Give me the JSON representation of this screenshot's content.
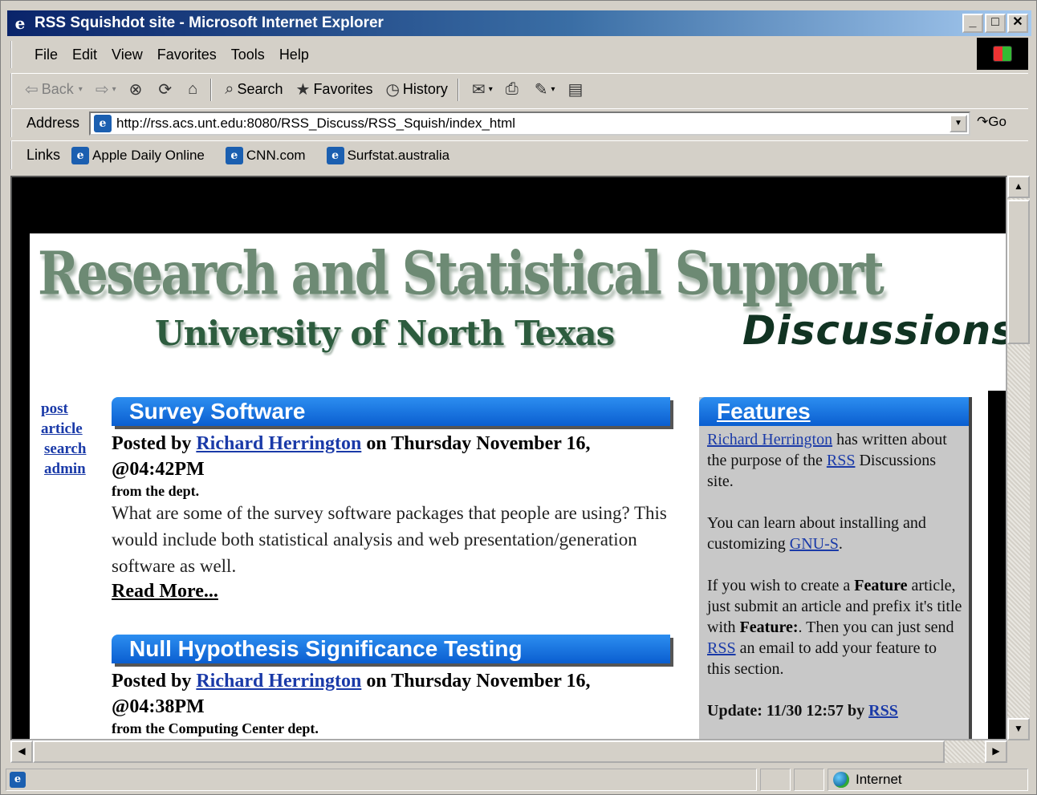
{
  "window": {
    "title": "RSS Squishdot site - Microsoft Internet Explorer"
  },
  "menu": [
    "File",
    "Edit",
    "View",
    "Favorites",
    "Tools",
    "Help"
  ],
  "toolbar": {
    "back": "Back",
    "search": "Search",
    "favorites": "Favorites",
    "history": "History"
  },
  "address": {
    "label": "Address",
    "url": "http://rss.acs.unt.edu:8080/RSS_Discuss/RSS_Squish/index_html",
    "go": "Go"
  },
  "links": {
    "label": "Links",
    "items": [
      "Apple Daily Online",
      "CNN.com",
      "Surfstat.australia"
    ]
  },
  "status": {
    "zone": "Internet"
  },
  "page": {
    "banner": {
      "title": "Research and Statistical Support",
      "subtitle": "University of North Texas",
      "section": "Discussions"
    },
    "nav": [
      "post",
      "article",
      "search",
      "admin"
    ],
    "stories": [
      {
        "title": "Survey Software",
        "posted_by": "Posted by",
        "author": "Richard Herrington",
        "date": "on Thursday November 16, @04:42PM",
        "dept": "from the dept.",
        "body": "What are some of the survey software packages that people are using? This would include both statistical analysis and web presentation/generation software as well.",
        "read_more": "Read More..."
      },
      {
        "title": "Null Hypothesis Significance Testing",
        "posted_by": "Posted by",
        "author": "Richard Herrington",
        "date": "on Thursday November 16, @04:38PM",
        "dept": "from the Computing Center dept."
      }
    ],
    "features": {
      "title": "Features",
      "p1_link": "Richard Herrington",
      "p1_text": "has written about the purpose of the",
      "p1_link2": "RSS",
      "p1_end": "Discussions site.",
      "p2_text": "You can learn about installing and customizing",
      "p2_link": "GNU-S",
      "p3_a": "If you wish to create a",
      "p3_b": "Feature",
      "p3_c": "article, just submit an article and prefix it's title with",
      "p3_d": "Feature:",
      "p3_e": ". Then you can just send",
      "p3_link": "RSS",
      "p3_f": "an email to add your feature to this section.",
      "update": "Update: 11/30 12:57 by",
      "update_link": "RSS"
    }
  }
}
